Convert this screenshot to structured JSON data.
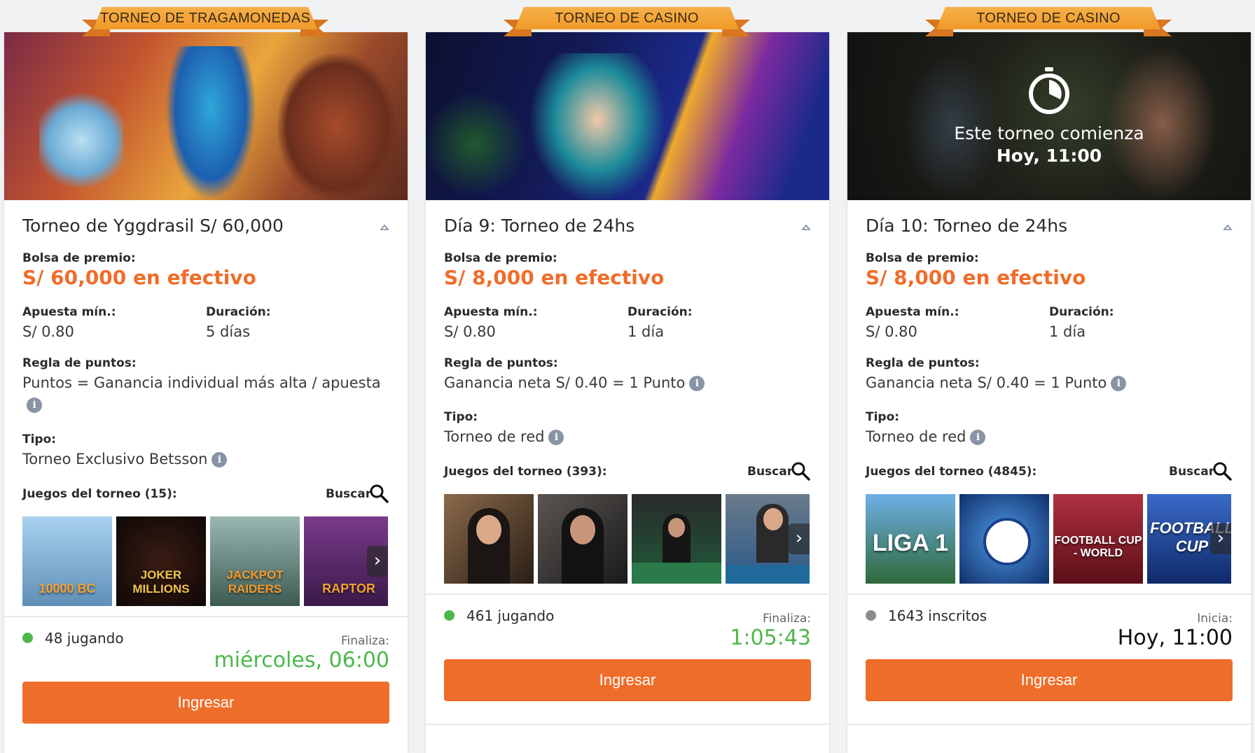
{
  "colors": {
    "accent": "#ef6d2a",
    "green": "#4cb84a",
    "grey_dot": "#8c8c8c",
    "info_icon": "#8893a4"
  },
  "cards": [
    {
      "ribbon": "TORNEO DE TRAGAMONEDAS",
      "title": "Torneo de Yggdrasil S/ 60,000",
      "prize_label": "Bolsa de premio:",
      "prize_value": "S/ 60,000 en efectivo",
      "min_bet_label": "Apuesta mín.:",
      "min_bet_value": "S/ 0.80",
      "duration_label": "Duración:",
      "duration_value": "5 días",
      "points_label": "Regla de puntos:",
      "points_value": "Puntos = Ganancia individual más alta / apuesta",
      "type_label": "Tipo:",
      "type_value": "Torneo Exclusivo Betsson",
      "games_label": "Juegos del torneo (15):",
      "search_label": "Buscar",
      "games": [
        {
          "name": "10000 BC",
          "color": "#7fb0d8"
        },
        {
          "name": "JOKER MILLIONS",
          "color": "#1a1210"
        },
        {
          "name": "JACKPOT RAIDERS",
          "color": "#6b8f8a"
        },
        {
          "name": "RAPTOR",
          "color": "#5a2a6a"
        }
      ],
      "players": "48 jugando",
      "status_dot": "green",
      "end_label": "Finaliza:",
      "end_value": "miércoles, 06:00",
      "button": "Ingresar"
    },
    {
      "ribbon": "TORNEO DE CASINO",
      "title": "Día 9: Torneo de 24hs",
      "prize_label": "Bolsa de premio:",
      "prize_value": "S/ 8,000 en efectivo",
      "min_bet_label": "Apuesta mín.:",
      "min_bet_value": "S/ 0.80",
      "duration_label": "Duración:",
      "duration_value": "1 día",
      "points_label": "Regla de puntos:",
      "points_value": "Ganancia neta S/ 0.40 = 1 Punto",
      "type_label": "Tipo:",
      "type_value": "Torneo de red",
      "games_label": "Juegos del torneo (393):",
      "search_label": "Buscar",
      "games": [
        {
          "name": "",
          "color": "#5a4a3c"
        },
        {
          "name": "",
          "color": "#3b3a3a"
        },
        {
          "name": "",
          "color": "#2f3a2f"
        },
        {
          "name": "",
          "color": "#4a5a6a"
        }
      ],
      "players": "461 jugando",
      "status_dot": "green",
      "end_label": "Finaliza:",
      "end_value": "1:05:43",
      "button": "Ingresar"
    },
    {
      "ribbon": "TORNEO DE CASINO",
      "starts_label": "Este torneo comienza",
      "starts_time": "Hoy, 11:00",
      "title": "Día 10: Torneo de 24hs",
      "prize_label": "Bolsa de premio:",
      "prize_value": "S/ 8,000 en efectivo",
      "min_bet_label": "Apuesta mín.:",
      "min_bet_value": "S/ 0.80",
      "duration_label": "Duración:",
      "duration_value": "1 día",
      "points_label": "Regla de puntos:",
      "points_value": "Ganancia neta S/ 0.40 = 1 Punto",
      "type_label": "Tipo:",
      "type_value": "Torneo de red",
      "games_label": "Juegos del torneo (4845):",
      "search_label": "Buscar",
      "games": [
        {
          "name": "LIGA 1",
          "color": "#2e6a3a"
        },
        {
          "name": "",
          "color": "#1d4f9a"
        },
        {
          "name": "FOOTBALL CUP - WORLD",
          "color": "#8a1f2a"
        },
        {
          "name": "FOOTBALL CUP",
          "color": "#1d3f8a"
        }
      ],
      "players": "1643 inscritos",
      "status_dot": "grey",
      "end_label": "Inicia:",
      "end_value": "Hoy, 11:00",
      "button": "Ingresar"
    }
  ]
}
